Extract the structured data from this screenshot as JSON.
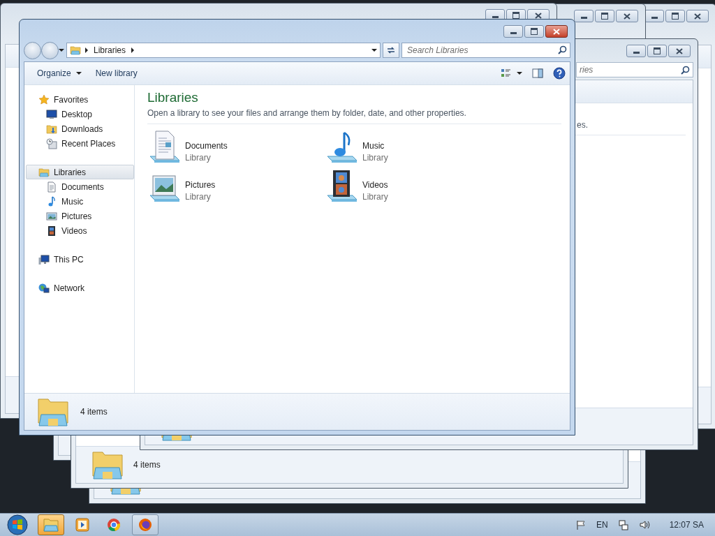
{
  "main_window": {
    "address": {
      "crumb": "Libraries"
    },
    "search": {
      "placeholder": "Search Libraries"
    },
    "toolbar": [
      {
        "label": "Organize",
        "dropdown": true
      },
      {
        "label": "New library",
        "dropdown": false
      }
    ],
    "navigation": [
      {
        "label": "Favorites",
        "kind": "star",
        "selected": false,
        "children": [
          {
            "label": "Desktop",
            "kind": "desktop",
            "selected": false
          },
          {
            "label": "Downloads",
            "kind": "downloads",
            "selected": false
          },
          {
            "label": "Recent Places",
            "kind": "recent",
            "selected": false
          }
        ]
      },
      {
        "label": "Libraries",
        "kind": "library",
        "selected": true,
        "children": [
          {
            "label": "Documents",
            "kind": "documents",
            "selected": false
          },
          {
            "label": "Music",
            "kind": "music",
            "selected": false
          },
          {
            "label": "Pictures",
            "kind": "pictures",
            "selected": false
          },
          {
            "label": "Videos",
            "kind": "videos",
            "selected": false
          }
        ]
      },
      {
        "label": "This PC",
        "kind": "computer",
        "selected": false
      },
      {
        "label": "Network",
        "kind": "network",
        "selected": false
      }
    ],
    "content": {
      "title": "Libraries",
      "subtitle": "Open a library to see your files and arrange them by folder, date, and other properties.",
      "items": [
        {
          "name": "Documents",
          "type": "Library",
          "kind": "documents"
        },
        {
          "name": "Music",
          "type": "Library",
          "kind": "music"
        },
        {
          "name": "Pictures",
          "type": "Library",
          "kind": "pictures"
        },
        {
          "name": "Videos",
          "type": "Library",
          "kind": "videos"
        }
      ]
    },
    "status": "4 items"
  },
  "background_windows": [
    {
      "status": "4 items"
    },
    {
      "search_placeholder": "ries",
      "subtitle": "es."
    }
  ],
  "taskbar": {
    "apps": [
      {
        "kind": "explorer",
        "selected": true
      },
      {
        "kind": "media",
        "selected": false
      },
      {
        "kind": "chrome",
        "selected": false
      },
      {
        "kind": "firefox",
        "selected": false
      }
    ],
    "language": "EN",
    "time": "12:07 SA"
  }
}
